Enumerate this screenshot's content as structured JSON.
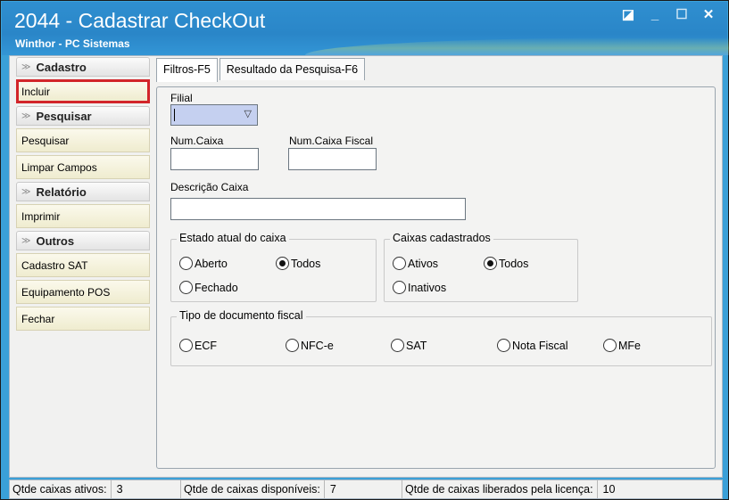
{
  "window": {
    "title": "2044 - Cadastrar CheckOut",
    "subtitle": "Winthor - PC Sistemas",
    "icons": [
      "restore-icon",
      "minimize-icon",
      "maximize-icon",
      "close-icon"
    ],
    "buttons": [
      "◪",
      "_",
      "☐",
      "✕"
    ]
  },
  "sidebar": {
    "groups": [
      {
        "title": "Cadastro",
        "items": [
          "Incluir"
        ]
      },
      {
        "title": "Pesquisar",
        "items": [
          "Pesquisar",
          "Limpar Campos"
        ]
      },
      {
        "title": "Relatório",
        "items": [
          "Imprimir"
        ]
      },
      {
        "title": "Outros",
        "items": [
          "Cadastro SAT",
          "Equipamento POS",
          "Fechar"
        ]
      }
    ],
    "highlight_color": "#d2252a"
  },
  "tabs": [
    "Filtros-F5",
    "Resultado da Pesquisa-F6"
  ],
  "form": {
    "filial_label": "Filial",
    "filial_value": "",
    "numcaixa_label": "Num.Caixa",
    "numcaixa_fiscal_label": "Num.Caixa Fiscal",
    "descricao_label": "Descrição Caixa",
    "estado": {
      "title": "Estado atual do caixa",
      "options": [
        "Aberto",
        "Todos",
        "Fechado"
      ],
      "selected": "Todos"
    },
    "cadastrados": {
      "title": "Caixas cadastrados",
      "options": [
        "Ativos",
        "Todos",
        "Inativos"
      ],
      "selected": "Todos"
    },
    "tipo_doc": {
      "title": "Tipo de documento fiscal",
      "options": [
        "ECF",
        "NFC-e",
        "SAT",
        "Nota Fiscal",
        "MFe"
      ],
      "selected": ""
    }
  },
  "status": [
    {
      "label": "Qtde caixas ativos:",
      "value": "3"
    },
    {
      "label": "Qtde de caixas disponíveis:",
      "value": "7"
    },
    {
      "label": "Qtde de caixas liberados pela licença:",
      "value": "10"
    }
  ],
  "colors": {
    "titlebar": "#2a86c8",
    "accent": "#3aa0d8"
  }
}
